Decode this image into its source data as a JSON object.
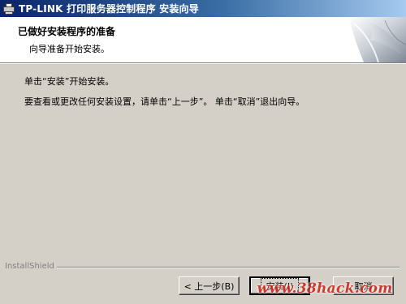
{
  "window": {
    "title": "TP-LINK 打印服务器控制程序 安装向导",
    "icon": "printer-icon"
  },
  "header": {
    "title": "已做好安装程序的准备",
    "subtitle": "向导准备开始安装。"
  },
  "body": {
    "line1": "单击“安装”开始安装。",
    "line2": "要查看或更改任何安装设置，请单击“上一步”。 单击“取消”退出向导。"
  },
  "footer": {
    "brand": "InstallShield",
    "buttons": {
      "back": "< 上一步(B)",
      "install": "安装(I)",
      "cancel": "取消"
    }
  },
  "watermark": "www.38hack.com",
  "colors": {
    "titlebar_start": "#0a246a",
    "titlebar_end": "#a6caf0",
    "dialog_bg": "#d4d0c8",
    "watermark": "#cc2a1e"
  }
}
